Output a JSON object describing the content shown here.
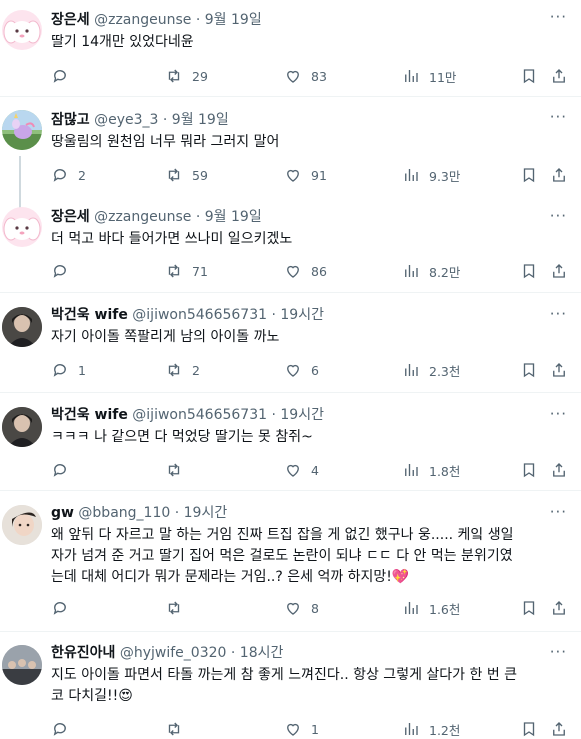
{
  "tweets": [
    {
      "name": "장은세",
      "handle": "@zzangeunse",
      "dot": "·",
      "time": "9월 19일",
      "more": "···",
      "text": "딸기 14개만 있었다네윤",
      "reply": "",
      "retweet": "29",
      "like": "83",
      "views": "11만",
      "avatar": "bunny-pink"
    },
    {
      "name": "잠많고",
      "handle": "@eye3_3",
      "dot": "·",
      "time": "9월 19일",
      "more": "···",
      "text": "땅울림의 원천임 너무 뭐라 그러지 말어",
      "reply": "2",
      "retweet": "59",
      "like": "91",
      "views": "9.3만",
      "avatar": "unicorn"
    },
    {
      "name": "장은세",
      "handle": "@zzangeunse",
      "dot": "·",
      "time": "9월 19일",
      "more": "···",
      "text": "더 먹고 바다 들어가면 쓰나미 일으키겠노",
      "reply": "",
      "retweet": "71",
      "like": "86",
      "views": "8.2만",
      "avatar": "bunny-pink"
    },
    {
      "name": "박건욱 wife",
      "handle": "@ijiwon546656731",
      "dot": "·",
      "time": "19시간",
      "more": "···",
      "text": "자기 아이돌 쪽팔리게 남의 아이돌 까노",
      "reply": "1",
      "retweet": "2",
      "like": "6",
      "views": "2.3천",
      "avatar": "photo-dark"
    },
    {
      "name": "박건욱 wife",
      "handle": "@ijiwon546656731",
      "dot": "·",
      "time": "19시간",
      "more": "···",
      "text": "ㅋㅋㅋ 나 같으면 다 먹었당 딸기는 못 참쥐~",
      "reply": "",
      "retweet": "",
      "like": "4",
      "views": "1.8천",
      "avatar": "photo-dark"
    },
    {
      "name": "gw",
      "handle": "@bbang_110",
      "dot": "·",
      "time": "19시간",
      "more": "···",
      "text": "왜 앞뒤 다 자르고 말 하는 거임 진짜 트집 잡을 게 없긴 했구나 웅..... 케잌 생일\n자가 넘겨 준 거고 딸기 집어 먹은 걸로도 논란이 되냐 ㄷㄷ 다 안 먹는 분위기였\n는데 대체 어디가 뭐가 문제라는 거임..? 은세 억까 하지망!💖",
      "reply": "",
      "retweet": "",
      "like": "8",
      "views": "1.6천",
      "avatar": "photo-face"
    },
    {
      "name": "한유진아내",
      "handle": "@hyjwife_0320",
      "dot": "·",
      "time": "18시간",
      "more": "···",
      "text": "지도 아이돌 파면서 타돌 까는게 참 좋게 느껴진다.. 항상 그렇게 살다가 한 번 큰\n코 다치길!!😍",
      "reply": "",
      "retweet": "",
      "like": "1",
      "views": "1.2천",
      "avatar": "photo-group"
    }
  ]
}
